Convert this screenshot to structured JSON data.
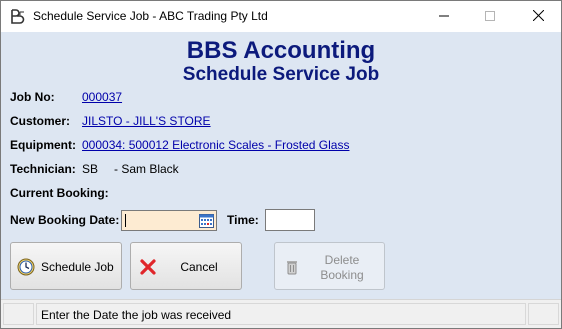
{
  "window": {
    "title": "Schedule Service Job  - ABC Trading Pty Ltd"
  },
  "header": {
    "app_name": "BBS Accounting",
    "form_title": "Schedule Service Job"
  },
  "fields": {
    "job_no_label": "Job No:",
    "job_no_value": "000037",
    "customer_label": "Customer:",
    "customer_value": "JILSTO - JILL'S STORE",
    "equipment_label": "Equipment:",
    "equipment_value": "000034: 500012 Electronic Scales - Frosted Glass",
    "technician_label": "Technician:",
    "technician_code": "SB",
    "technician_name": "- Sam Black",
    "current_booking_label": "Current Booking:",
    "new_booking_label": "New Booking Date:",
    "new_booking_value": "",
    "time_label": "Time:",
    "time_value": ""
  },
  "buttons": {
    "schedule_label": "Schedule Job",
    "cancel_label": "Cancel",
    "delete_label_line1": "Delete",
    "delete_label_line2": "Booking"
  },
  "statusbar": {
    "message": "Enter the Date the job was received"
  },
  "icons": {
    "app": "app-logo-icon",
    "calendar": "calendar-icon",
    "schedule": "clock-icon",
    "cancel": "cancel-x-icon",
    "delete": "trash-bin-icon"
  },
  "colors": {
    "heading": "#0c1a7c",
    "link": "#0000aa",
    "form_background": "#dde6f2",
    "date_field": "#fdebd2",
    "cancel_x": "#e0262a"
  }
}
